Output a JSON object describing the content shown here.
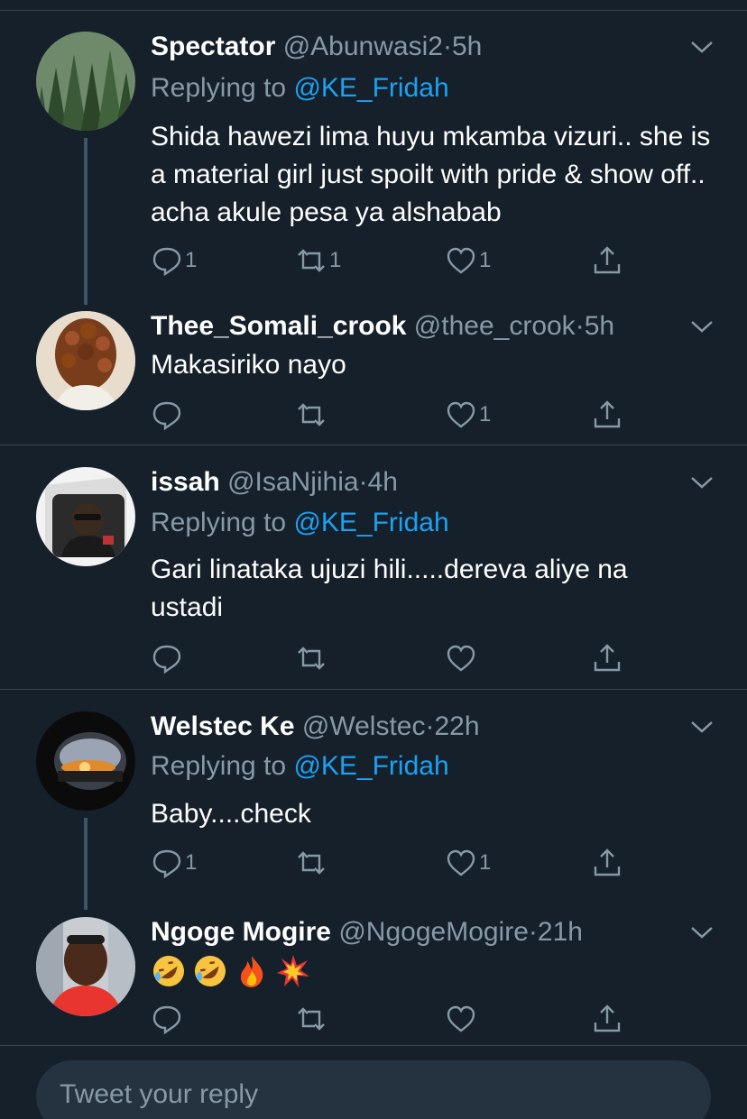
{
  "colors": {
    "background": "#15202b",
    "divider": "#38444d",
    "secondary_text": "#8899a6",
    "link": "#1da1f2",
    "thread_line": "#3d5466"
  },
  "tweets": [
    {
      "name": "Spectator",
      "handle": "@Abunwasi2",
      "dot": "·",
      "time": "5h",
      "replying_prefix": "Replying to ",
      "replying_mention": "@KE_Fridah",
      "text": "Shida hawezi lima huyu mkamba vizuri.. she is a material girl just spoilt with pride & show off.. acha akule pesa ya alshabab",
      "reply_count": "1",
      "retweet_count": "1",
      "like_count": "1"
    },
    {
      "name": "Thee_Somali_crook",
      "handle": "@thee_crook",
      "dot": "·",
      "time": "5h",
      "text": "Makasiriko nayo",
      "reply_count": "",
      "retweet_count": "",
      "like_count": "1"
    },
    {
      "name": "issah",
      "handle": "@IsaNjihia",
      "dot": "·",
      "time": "4h",
      "replying_prefix": "Replying to ",
      "replying_mention": "@KE_Fridah",
      "text": "Gari linataka ujuzi hili.....dereva aliye na ustadi",
      "reply_count": "",
      "retweet_count": "",
      "like_count": ""
    },
    {
      "name": "Welstec Ke",
      "handle": "@Welstec",
      "dot": "·",
      "time": "22h",
      "replying_prefix": "Replying to ",
      "replying_mention": "@KE_Fridah",
      "text": "Baby....check",
      "reply_count": "1",
      "retweet_count": "",
      "like_count": "1"
    },
    {
      "name": "Ngoge Mogire",
      "handle": "@NgogeMogire",
      "dot": "·",
      "time": "21h",
      "emojis": [
        "rolling-on-floor-laughing-emoji",
        "rolling-on-floor-laughing-emoji",
        "fire-emoji",
        "collision-emoji"
      ],
      "reply_count": "",
      "retweet_count": "",
      "like_count": ""
    }
  ],
  "reply_bar": {
    "placeholder": "Tweet your reply"
  }
}
